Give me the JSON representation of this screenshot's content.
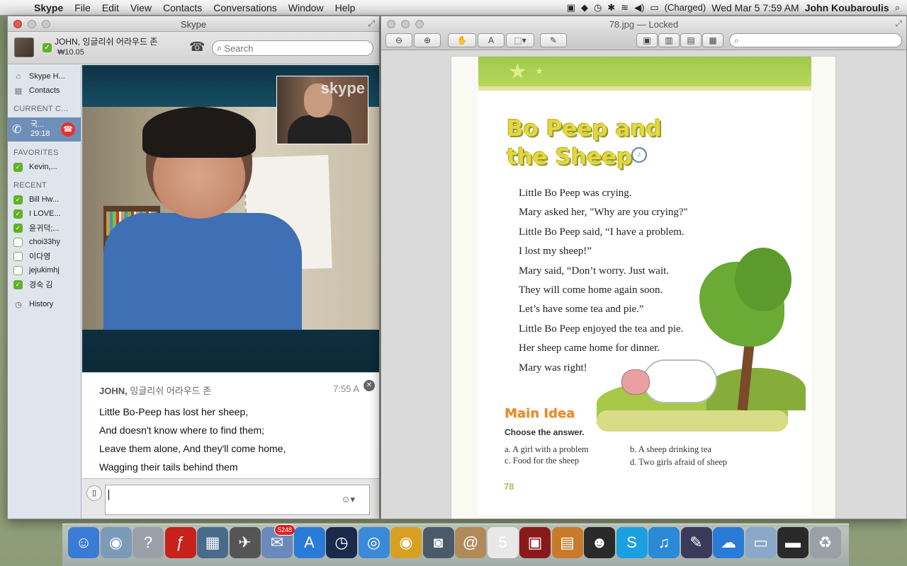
{
  "menubar": {
    "apple": "",
    "items": [
      "Skype",
      "File",
      "Edit",
      "View",
      "Contacts",
      "Conversations",
      "Window",
      "Help"
    ],
    "battery": "(Charged)",
    "datetime": "Wed Mar 5  7:59 AM",
    "user": "John Koubaroulis"
  },
  "skype": {
    "title": "Skype",
    "profile_name": "JOHN, 잉글리쉬 어라우드 존",
    "credit": "₩10.05",
    "search_placeholder": "Search",
    "nav": {
      "home": "Skype H...",
      "contacts": "Contacts",
      "current_heading": "CURRENT C...",
      "call_name": "국...",
      "call_timer": "29:18",
      "favorites_heading": "FAVORITES",
      "favorites": [
        "Kevin,..."
      ],
      "recent_heading": "RECENT",
      "recent": [
        {
          "name": "Bill Hw...",
          "online": true
        },
        {
          "name": "I LOVE...",
          "online": true
        },
        {
          "name": "윤귀덕;...",
          "online": true
        },
        {
          "name": "choi33hy",
          "online": false
        },
        {
          "name": "이다영",
          "online": false
        },
        {
          "name": "jejukimhj",
          "online": false
        },
        {
          "name": "경숙 김",
          "online": true
        }
      ],
      "history": "History"
    },
    "video": {
      "watermark": "skype"
    },
    "chat": {
      "author": "JOHN,",
      "author_rest": " 잉글리쉬 어라우드 존",
      "time": "7:55 A",
      "lines": [
        "Little Bo-Peep has lost her sheep,",
        "And doesn't know where to find them;",
        "Leave them alone, And they'll come home,",
        "Wagging their tails behind them"
      ]
    }
  },
  "preview": {
    "title": "78.jpg — Locked",
    "page": {
      "title_line1": "Bo Peep and",
      "title_line2": "the Sheep",
      "story": [
        "Little Bo Peep was crying.",
        "Mary asked her, \"Why are you crying?\"",
        "Little Bo Peep said, “I have a problem.",
        "I lost my sheep!”",
        "Mary said, “Don’t worry. Just wait.",
        "They will come home again soon.",
        "Let’s have some tea and pie.”",
        "Little Bo Peep enjoyed the tea and pie.",
        "Her sheep came home for dinner.",
        "Mary was right!"
      ],
      "main_idea": "Main Idea",
      "choose": "Choose the answer.",
      "answers": {
        "a": "a.  A girl with a problem",
        "b": "b.  A sheep drinking tea",
        "c": "c.  Food for the sheep",
        "d": "d.  Two girls afraid of sheep"
      },
      "page_number": "78"
    }
  },
  "dock": {
    "items": [
      {
        "name": "finder",
        "color": "#3a7bd5",
        "glyph": "☺"
      },
      {
        "name": "preview",
        "color": "#7a9ab8",
        "glyph": "◉"
      },
      {
        "name": "help",
        "color": "#9aa0a8",
        "glyph": "?"
      },
      {
        "name": "flash",
        "color": "#c8201a",
        "glyph": "ƒ"
      },
      {
        "name": "photo-booth",
        "color": "#4a6a8a",
        "glyph": "▦"
      },
      {
        "name": "launchpad",
        "color": "#555",
        "glyph": "✈"
      },
      {
        "name": "mail",
        "color": "#6a8abb",
        "glyph": "✉",
        "badge": "5248"
      },
      {
        "name": "app-store",
        "color": "#2a7ad8",
        "glyph": "A"
      },
      {
        "name": "dashboard",
        "color": "#1a2a4a",
        "glyph": "◷"
      },
      {
        "name": "safari",
        "color": "#3a8ad8",
        "glyph": "◎"
      },
      {
        "name": "chrome",
        "color": "#d8a020",
        "glyph": "◉"
      },
      {
        "name": "camera",
        "color": "#4a5a6a",
        "glyph": "◙"
      },
      {
        "name": "contacts",
        "color": "#b08a5a",
        "glyph": "@"
      },
      {
        "name": "calendar",
        "color": "#e8e8e8",
        "glyph": "5"
      },
      {
        "name": "photos",
        "color": "#8a1a1a",
        "glyph": "▣"
      },
      {
        "name": "iphoto",
        "color": "#c87a2a",
        "glyph": "▤"
      },
      {
        "name": "qq",
        "color": "#2a2a2a",
        "glyph": "☻"
      },
      {
        "name": "skype",
        "color": "#1aa0e0",
        "glyph": "S"
      },
      {
        "name": "itunes",
        "color": "#2a8ad8",
        "glyph": "♫"
      },
      {
        "name": "pen",
        "color": "#3a3a5a",
        "glyph": "✎"
      },
      {
        "name": "openoffice",
        "color": "#2a7ad8",
        "glyph": "☁"
      },
      {
        "name": "screenshot",
        "color": "#8aa8c8",
        "glyph": "▭"
      },
      {
        "name": "monitor",
        "color": "#2a2a2a",
        "glyph": "▬"
      },
      {
        "name": "trash",
        "color": "#9aa0a8",
        "glyph": "♻"
      }
    ]
  }
}
